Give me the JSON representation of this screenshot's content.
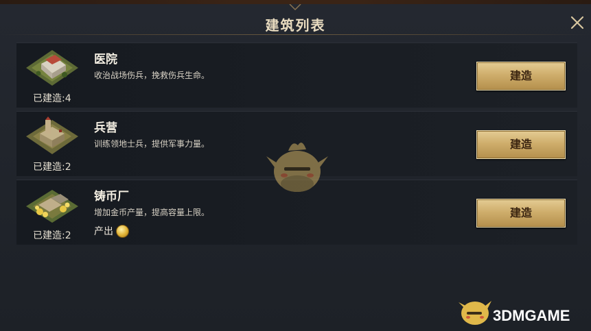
{
  "title": "建筑列表",
  "buildings": [
    {
      "name": "医院",
      "description": "收治战场伤兵，挽救伤兵生命。",
      "built": "已建造:4",
      "button": "建造"
    },
    {
      "name": "兵营",
      "description": "训练领地士兵，提供军事力量。",
      "built": "已建造:2",
      "button": "建造"
    },
    {
      "name": "铸币厂",
      "description": "增加金币产量，提高容量上限。",
      "built": "已建造:2",
      "button": "建造",
      "produce": "产出"
    }
  ],
  "watermark": "3DMGAME",
  "colors": {
    "accent": "#cfae6c",
    "panel": "#1f2329",
    "title": "#e9dcc0"
  },
  "icons": {
    "close": "close-icon",
    "coin": "gold-coin-icon"
  }
}
